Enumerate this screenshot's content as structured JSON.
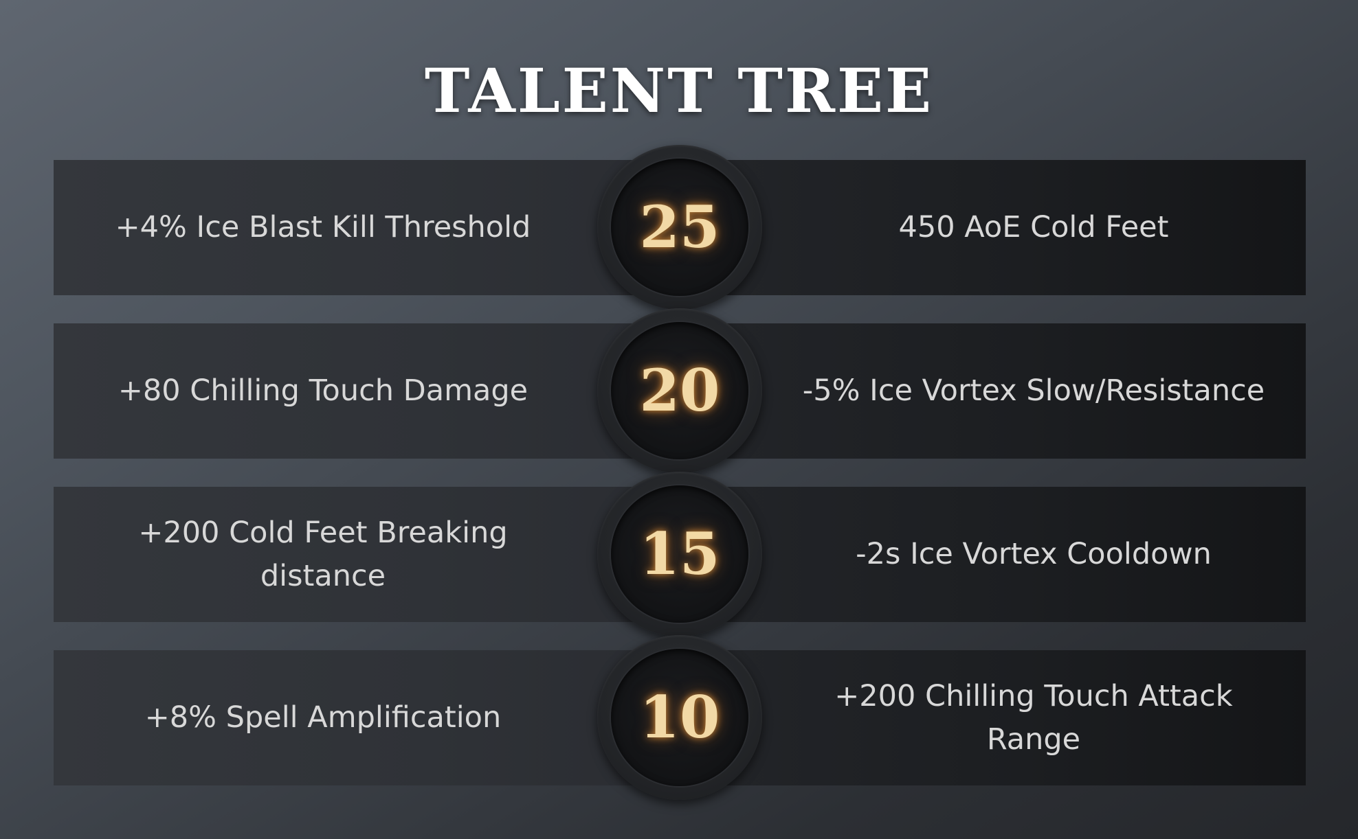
{
  "title": "TALENT TREE",
  "tiers": [
    {
      "level": "25",
      "left": "+4% Ice Blast Kill Threshold",
      "right": "450 AoE Cold Feet"
    },
    {
      "level": "20",
      "left": "+80 Chilling Touch Damage",
      "right": "-5% Ice Vortex Slow/Resistance"
    },
    {
      "level": "15",
      "left": "+200 Cold Feet Breaking distance",
      "right": "-2s Ice Vortex Cooldown"
    },
    {
      "level": "10",
      "left": "+8% Spell Amplification",
      "right": "+200 Chilling Touch Attack Range"
    }
  ],
  "colors": {
    "level_number": "#f2d9a6",
    "level_glow": "#e4963c",
    "talent_text": "#d8d8d8",
    "title": "#ffffff"
  }
}
